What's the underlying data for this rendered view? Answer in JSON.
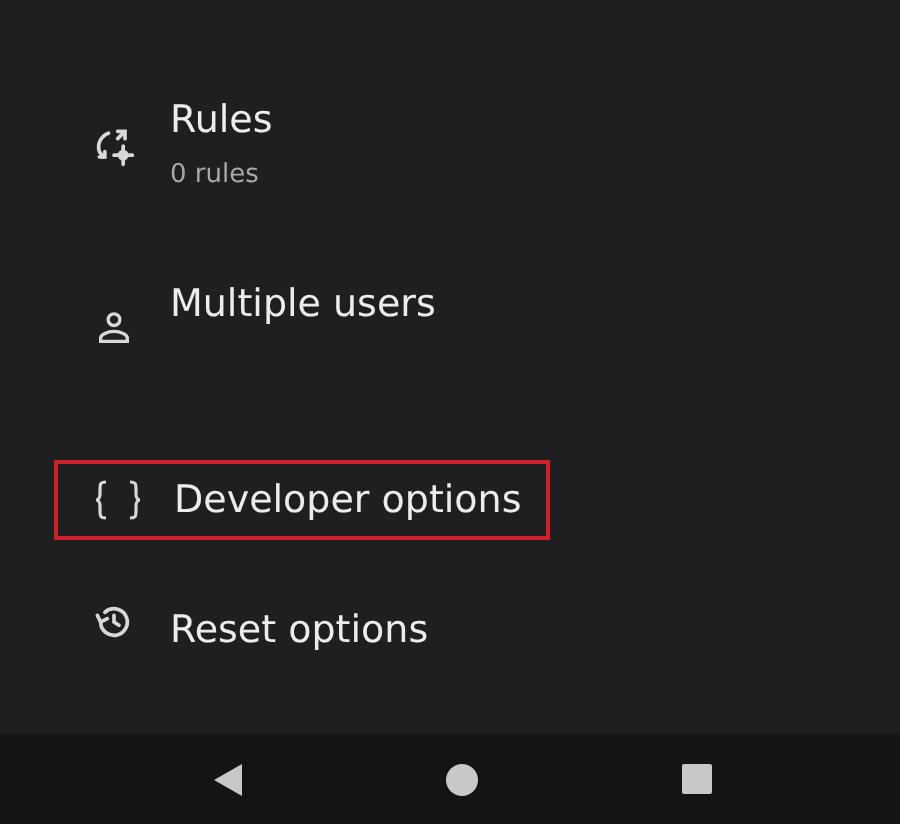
{
  "settings_items": [
    {
      "title": "Rules",
      "subtitle": "0 rules",
      "highlighted": false
    },
    {
      "title": "Multiple users",
      "highlighted": false
    },
    {
      "title": "Developer options",
      "highlighted": true
    },
    {
      "title": "Reset options",
      "highlighted": false
    }
  ]
}
